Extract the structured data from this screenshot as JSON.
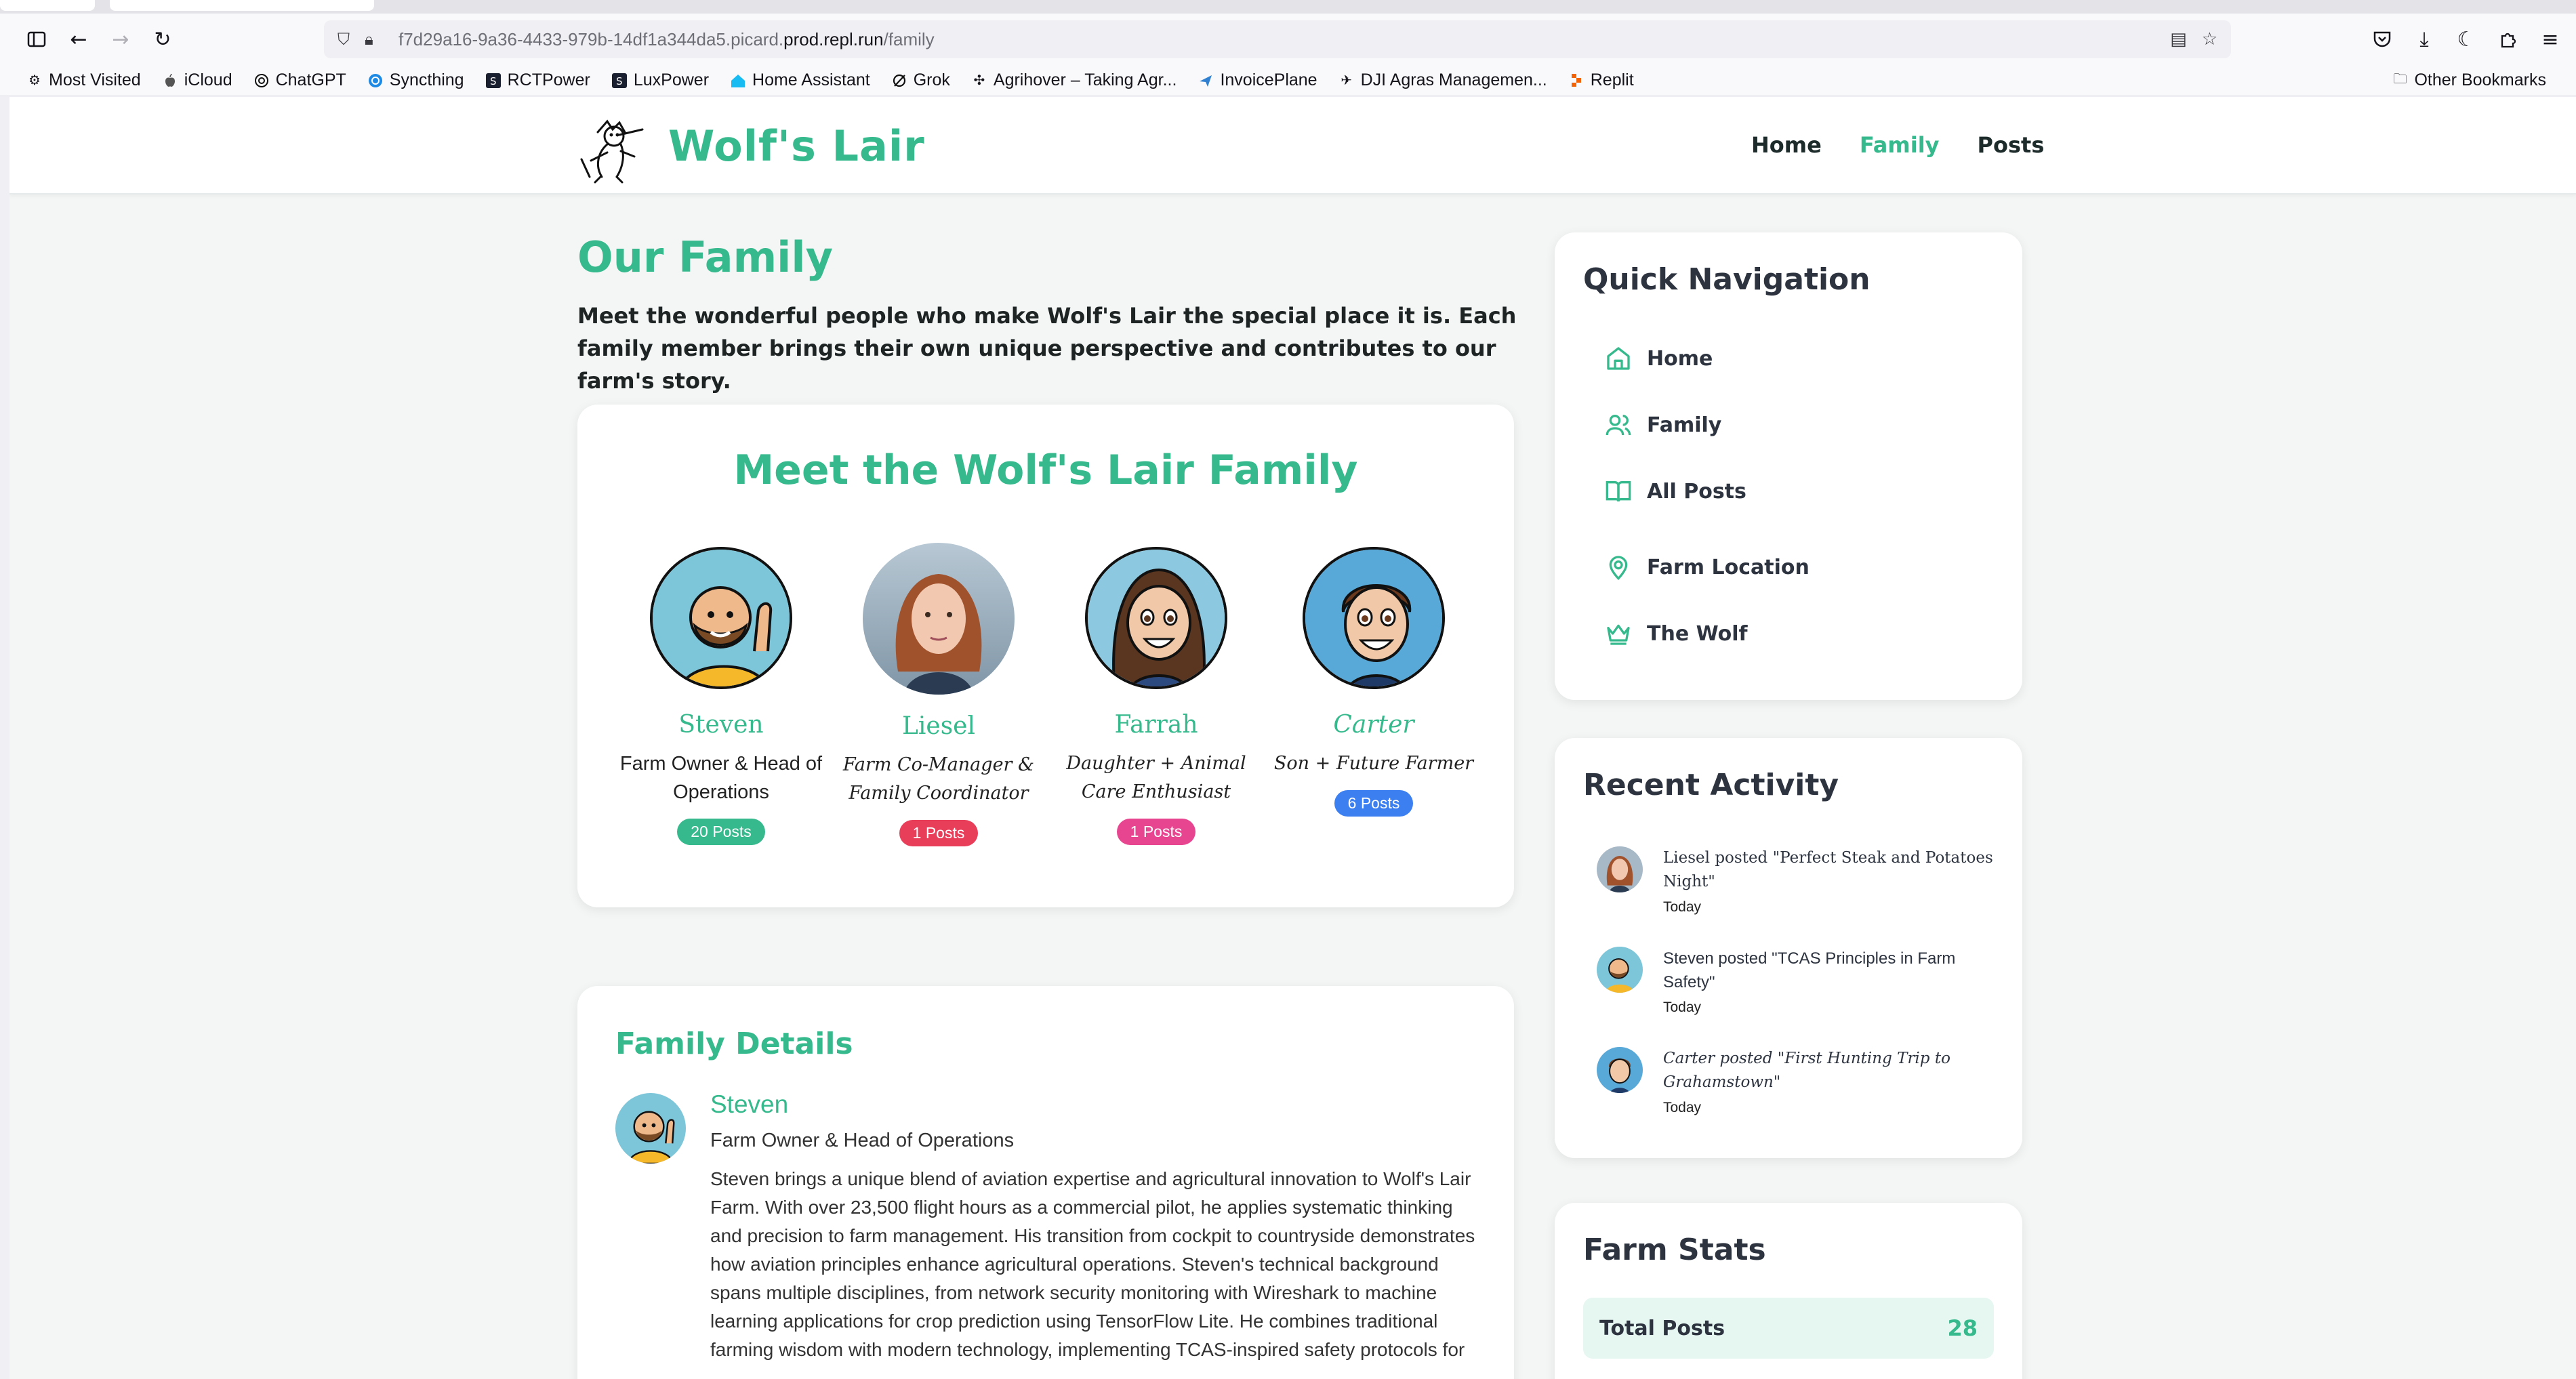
{
  "browser": {
    "url_prefix": "f7d29a16-9a36-4433-979b-14df1a344da5.picard.",
    "url_domain": "prod.repl.run",
    "url_path": "/family",
    "bookmarks": [
      {
        "label": "Most Visited",
        "icon": "gear-icon"
      },
      {
        "label": "iCloud",
        "icon": "apple-icon"
      },
      {
        "label": "ChatGPT",
        "icon": "chatgpt-icon"
      },
      {
        "label": "Syncthing",
        "icon": "syncthing-icon"
      },
      {
        "label": "RCTPower",
        "icon": "rctpower-icon"
      },
      {
        "label": "LuxPower",
        "icon": "luxpower-icon"
      },
      {
        "label": "Home Assistant",
        "icon": "home-assistant-icon"
      },
      {
        "label": "Grok",
        "icon": "grok-icon"
      },
      {
        "label": "Agrihover – Taking Agr...",
        "icon": "agrihover-icon"
      },
      {
        "label": "InvoicePlane",
        "icon": "invoiceplane-icon"
      },
      {
        "label": "DJI Agras Managemen...",
        "icon": "dji-icon"
      },
      {
        "label": "Replit",
        "icon": "replit-icon"
      }
    ],
    "other_bookmarks": "Other Bookmarks"
  },
  "site": {
    "name": "Wolf's Lair",
    "nav": [
      {
        "label": "Home",
        "active": false
      },
      {
        "label": "Family",
        "active": true
      },
      {
        "label": "Posts",
        "active": false
      }
    ],
    "accent": "#36b98d"
  },
  "main": {
    "title": "Our Family",
    "intro": "Meet the wonderful people who make Wolf's Lair the special place it is. Each family member brings their own unique perspective and contributes to our farm's story.",
    "family_heading": "Meet the Wolf's Lair Family",
    "members": [
      {
        "name": "Steven",
        "role": "Farm Owner & Head of Operations",
        "posts": "20 Posts",
        "badge_color": "#36b98d"
      },
      {
        "name": "Liesel",
        "role": "Farm Co-Manager & Family Coordinator",
        "posts": "1 Posts",
        "badge_color": "#e83e5a"
      },
      {
        "name": "Farrah",
        "role": "Daughter + Animal Care Enthusiast",
        "posts": "1 Posts",
        "badge_color": "#e84590"
      },
      {
        "name": "Carter",
        "role": "Son + Future Farmer",
        "posts": "6 Posts",
        "badge_color": "#3b7ff0"
      }
    ],
    "details_heading": "Family Details",
    "detail": {
      "name": "Steven",
      "role": "Farm Owner & Head of Operations",
      "bio": "Steven brings a unique blend of aviation expertise and agricultural innovation to Wolf's Lair Farm. With over 23,500 flight hours as a commercial pilot, he applies systematic thinking and precision to farm management. His transition from cockpit to countryside demonstrates how aviation principles enhance agricultural operations. Steven's technical background spans multiple disciplines, from network security monitoring with Wireshark to machine learning applications for crop prediction using TensorFlow Lite. He combines traditional farming wisdom with modern technology, implementing TCAS-inspired safety protocols for"
    }
  },
  "sidebar": {
    "quick_nav_title": "Quick Navigation",
    "quick_nav": [
      {
        "label": "Home",
        "icon": "home-icon"
      },
      {
        "label": "Family",
        "icon": "users-icon"
      },
      {
        "label": "All Posts",
        "icon": "book-icon"
      },
      {
        "label": "Farm Location",
        "icon": "map-pin-icon"
      },
      {
        "label": "The Wolf",
        "icon": "crown-icon"
      }
    ],
    "recent_title": "Recent Activity",
    "recent": [
      {
        "text": "Liesel posted \"Perfect Steak and Potatoes Night\"",
        "time": "Today"
      },
      {
        "text": "Steven posted \"TCAS Principles in Farm Safety\"",
        "time": "Today"
      },
      {
        "text": "Carter posted \"First Hunting Trip to Grahamstown\"",
        "time": "Today"
      }
    ],
    "stats_title": "Farm Stats",
    "stats": [
      {
        "label": "Total Posts",
        "value": "28"
      }
    ]
  }
}
